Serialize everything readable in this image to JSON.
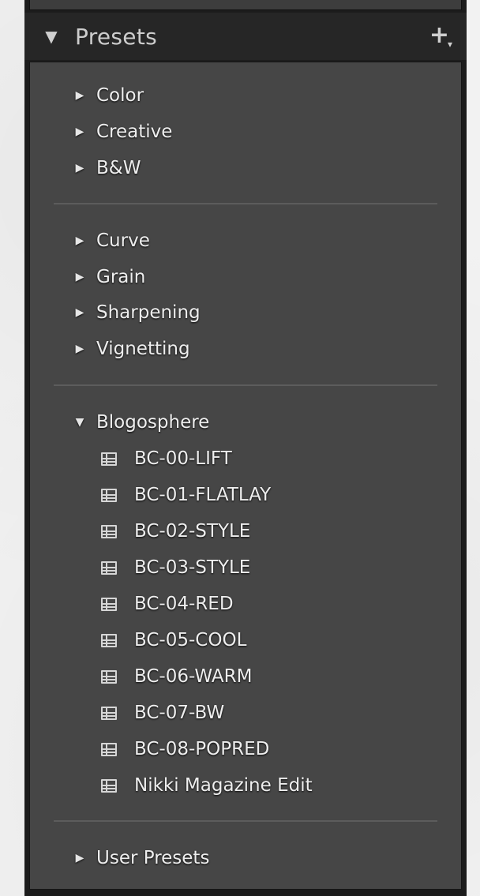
{
  "panel": {
    "title": "Presets",
    "add_label": "+",
    "add_menu_glyph": "▾",
    "collapse_glyph": "▼"
  },
  "groups": [
    {
      "label": "Color",
      "state": "collapsed"
    },
    {
      "label": "Creative",
      "state": "collapsed"
    },
    {
      "label": "B&W",
      "state": "collapsed"
    },
    {
      "label": "Curve",
      "state": "collapsed"
    },
    {
      "label": "Grain",
      "state": "collapsed"
    },
    {
      "label": "Sharpening",
      "state": "collapsed"
    },
    {
      "label": "Vignetting",
      "state": "collapsed"
    },
    {
      "label": "Blogosphere",
      "state": "expanded"
    },
    {
      "label": "User Presets",
      "state": "collapsed"
    }
  ],
  "blogosphere_presets": [
    "BC-00-LIFT",
    "BC-01-FLATLAY",
    "BC-02-STYLE",
    "BC-03-STYLE",
    "BC-04-RED",
    "BC-05-COOL",
    "BC-06-WARM",
    "BC-07-BW",
    "BC-08-POPRED",
    "Nikki Magazine Edit"
  ],
  "glyphs": {
    "collapsed": "▶",
    "expanded": "▼"
  },
  "icons": {
    "preset": "preset-list-icon"
  },
  "colors": {
    "panel_bg": "#464646",
    "header_bg": "#262626",
    "text": "#eeeeee"
  }
}
